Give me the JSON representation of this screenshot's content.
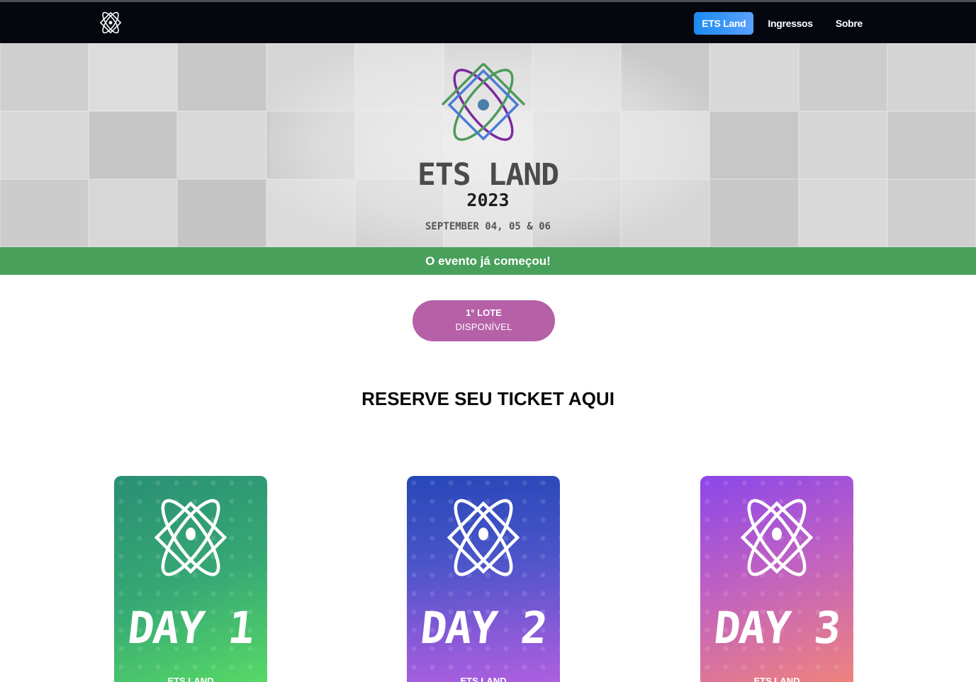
{
  "nav": {
    "logo_icon": "atom-icon",
    "links": [
      {
        "label": "ETS Land",
        "active": true
      },
      {
        "label": "Ingressos",
        "active": false
      },
      {
        "label": "Sobre",
        "active": false
      }
    ]
  },
  "hero": {
    "title": "ETS LAND",
    "year": "2023",
    "date": "SEPTEMBER 04, 05 & 06",
    "logo_icon": "atom-icon"
  },
  "banner": {
    "text": "O evento já começou!",
    "color": "#48a05a"
  },
  "lote": {
    "line1": "1° LOTE",
    "line2": "DISPONÍVEL",
    "color": "#b660a8"
  },
  "tickets": {
    "title": "RESERVE SEU TICKET AQUI",
    "cards": [
      {
        "day": "DAY 1",
        "sub": "ETS LAND"
      },
      {
        "day": "DAY 2",
        "sub": "ETS LAND"
      },
      {
        "day": "DAY 3",
        "sub": "ETS LAND"
      }
    ]
  },
  "colors": {
    "navbar_bg": "#05070f",
    "active_link": "#1b8bf0",
    "day1": "#36a874",
    "day2": "#4b55c9",
    "day3": "#c061c2"
  }
}
